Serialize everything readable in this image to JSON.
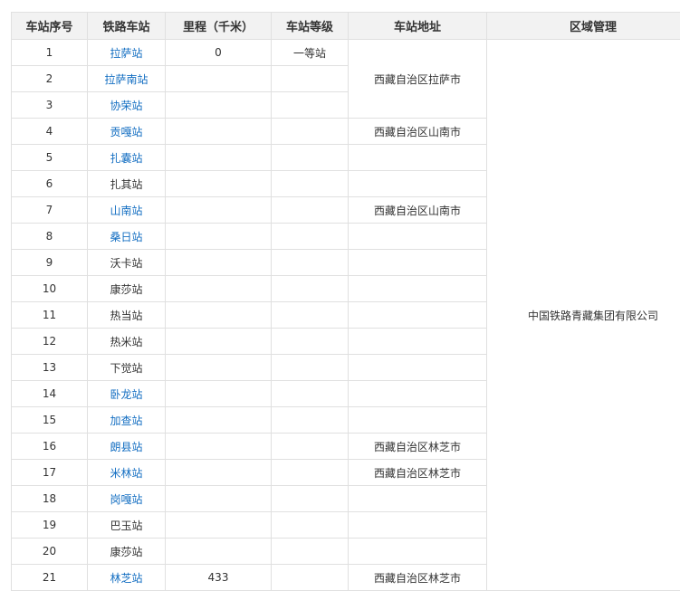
{
  "table": {
    "headers": [
      "车站序号",
      "铁路车站",
      "里程（千米）",
      "车站等级",
      "车站地址",
      "区域管理"
    ],
    "region_management": "中国铁路青藏集团有限公司",
    "rows": [
      {
        "seq": "1",
        "station": "拉萨站",
        "linked": true,
        "km": "0",
        "grade": "一等站"
      },
      {
        "seq": "2",
        "station": "拉萨南站",
        "linked": true,
        "km": "",
        "grade": ""
      },
      {
        "seq": "3",
        "station": "协荣站",
        "linked": true,
        "km": "",
        "grade": ""
      },
      {
        "seq": "4",
        "station": "贡嘎站",
        "linked": true,
        "km": "",
        "grade": ""
      },
      {
        "seq": "5",
        "station": "扎囊站",
        "linked": true,
        "km": "",
        "grade": ""
      },
      {
        "seq": "6",
        "station": "扎其站",
        "linked": false,
        "km": "",
        "grade": ""
      },
      {
        "seq": "7",
        "station": "山南站",
        "linked": true,
        "km": "",
        "grade": ""
      },
      {
        "seq": "8",
        "station": "桑日站",
        "linked": true,
        "km": "",
        "grade": ""
      },
      {
        "seq": "9",
        "station": "沃卡站",
        "linked": false,
        "km": "",
        "grade": ""
      },
      {
        "seq": "10",
        "station": "康莎站",
        "linked": false,
        "km": "",
        "grade": ""
      },
      {
        "seq": "11",
        "station": "热当站",
        "linked": false,
        "km": "",
        "grade": ""
      },
      {
        "seq": "12",
        "station": "热米站",
        "linked": false,
        "km": "",
        "grade": ""
      },
      {
        "seq": "13",
        "station": "下觉站",
        "linked": false,
        "km": "",
        "grade": ""
      },
      {
        "seq": "14",
        "station": "卧龙站",
        "linked": true,
        "km": "",
        "grade": ""
      },
      {
        "seq": "15",
        "station": "加查站",
        "linked": true,
        "km": "",
        "grade": ""
      },
      {
        "seq": "16",
        "station": "朗县站",
        "linked": true,
        "km": "",
        "grade": ""
      },
      {
        "seq": "17",
        "station": "米林站",
        "linked": true,
        "km": "",
        "grade": ""
      },
      {
        "seq": "18",
        "station": "岗嘎站",
        "linked": true,
        "km": "",
        "grade": ""
      },
      {
        "seq": "19",
        "station": "巴玉站",
        "linked": false,
        "km": "",
        "grade": ""
      },
      {
        "seq": "20",
        "station": "康莎站",
        "linked": false,
        "km": "",
        "grade": ""
      },
      {
        "seq": "21",
        "station": "林芝站",
        "linked": true,
        "km": "433",
        "grade": ""
      }
    ],
    "address_groups": [
      {
        "rowspan": 3,
        "text": "西藏自治区拉萨市"
      },
      {
        "rowspan": 1,
        "text": "西藏自治区山南市"
      },
      {
        "rowspan": 1,
        "text": ""
      },
      {
        "rowspan": 1,
        "text": ""
      },
      {
        "rowspan": 1,
        "text": "西藏自治区山南市"
      },
      {
        "rowspan": 1,
        "text": ""
      },
      {
        "rowspan": 1,
        "text": ""
      },
      {
        "rowspan": 1,
        "text": ""
      },
      {
        "rowspan": 1,
        "text": ""
      },
      {
        "rowspan": 1,
        "text": ""
      },
      {
        "rowspan": 1,
        "text": ""
      },
      {
        "rowspan": 1,
        "text": ""
      },
      {
        "rowspan": 1,
        "text": ""
      },
      {
        "rowspan": 1,
        "text": "西藏自治区林芝市"
      },
      {
        "rowspan": 1,
        "text": "西藏自治区林芝市"
      },
      {
        "rowspan": 1,
        "text": ""
      },
      {
        "rowspan": 1,
        "text": ""
      },
      {
        "rowspan": 1,
        "text": ""
      },
      {
        "rowspan": 1,
        "text": "西藏自治区林芝市"
      }
    ],
    "colors": {
      "link": "#136ec2",
      "text": "#333333",
      "header_bg": "#f2f2f2",
      "border": "#e0e0e0"
    }
  }
}
